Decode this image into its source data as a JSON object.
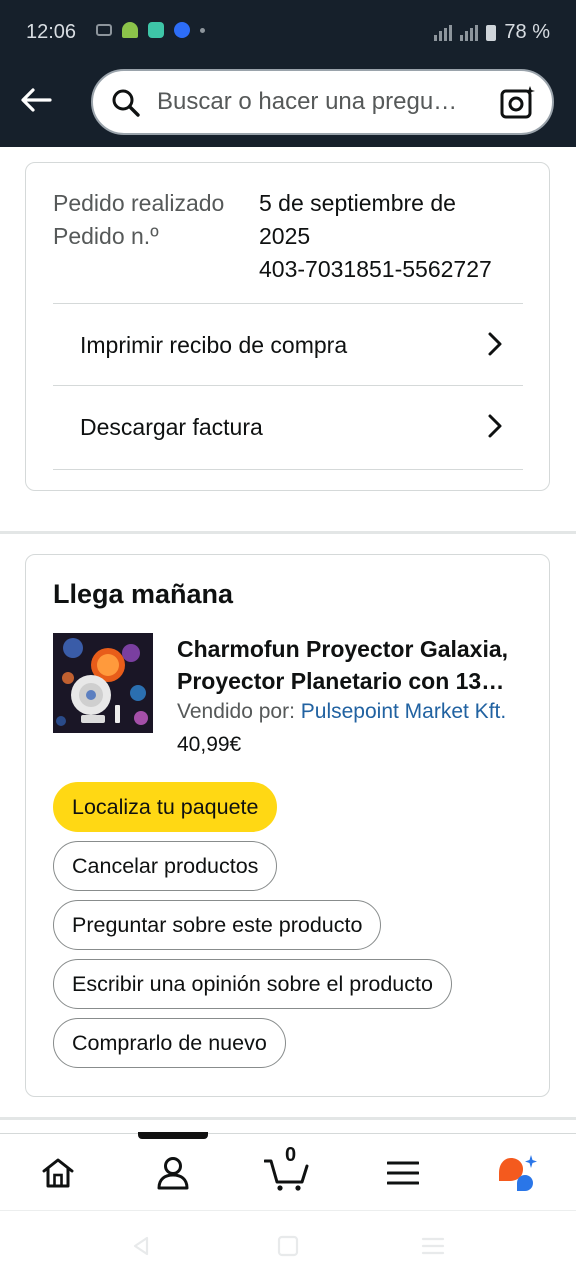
{
  "status_bar": {
    "time": "12:06",
    "battery": "78 %"
  },
  "search": {
    "placeholder": "Buscar o hacer una pregu…"
  },
  "order": {
    "labels": [
      "Pedido realizado",
      "Pedido n.º"
    ],
    "date_line1": "5 de septiembre de",
    "date_line2": "2025",
    "order_number": "403-7031851-5562727",
    "links": [
      "Imprimir recibo de compra",
      "Descargar factura"
    ]
  },
  "shipment": {
    "title": "Llega mañana",
    "product": {
      "title_line1": "Charmofun Proyector Galaxia,",
      "title_line2": "Proyector Planetario con 13…",
      "sold_by_label": "Vendido por: ",
      "seller": "Pulsepoint Market Kft.",
      "price": "40,99€"
    },
    "actions": {
      "track": "Localiza tu paquete",
      "cancel": "Cancelar productos",
      "ask": "Preguntar sobre este producto",
      "review": "Escribir una opinión sobre el producto",
      "buy_again": "Comprarlo de nuevo"
    }
  },
  "nav": {
    "cart_count": "0"
  },
  "colors": {
    "header_bg": "#16202b",
    "primary_button": "#ffd814",
    "link": "#2162a1"
  }
}
